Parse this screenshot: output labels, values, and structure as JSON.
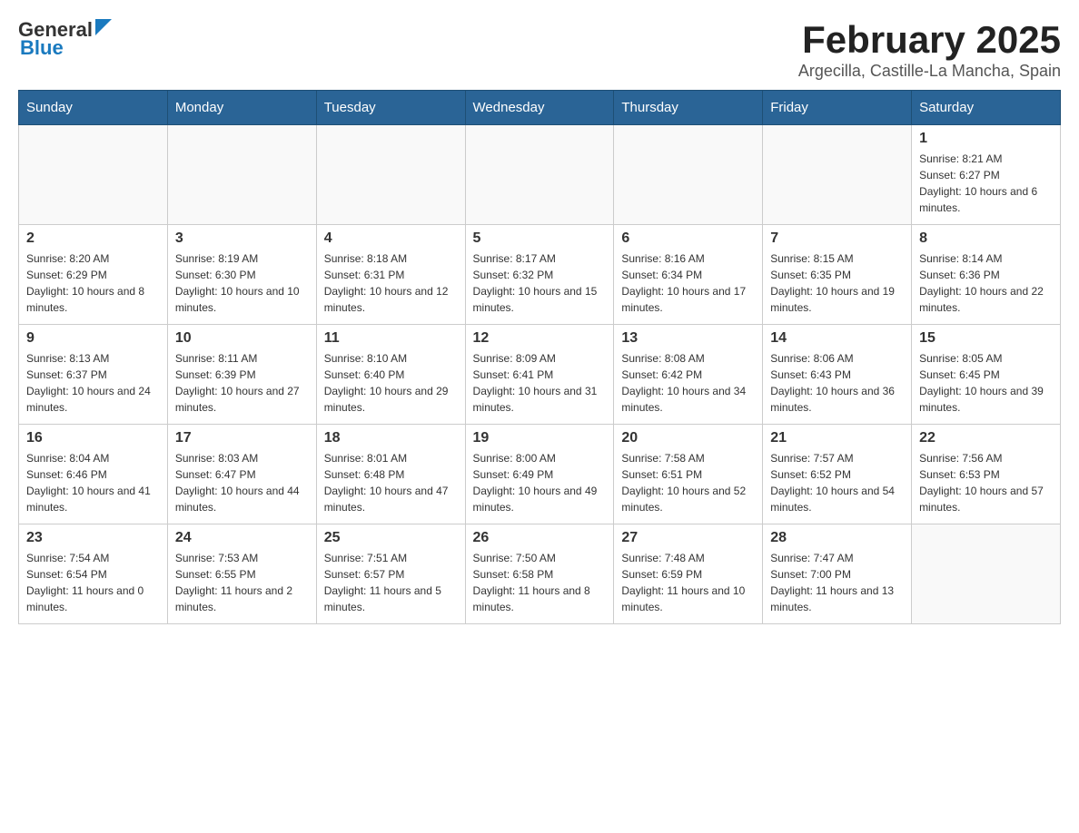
{
  "logo": {
    "general": "General",
    "blue": "Blue"
  },
  "title": "February 2025",
  "location": "Argecilla, Castille-La Mancha, Spain",
  "weekdays": [
    "Sunday",
    "Monday",
    "Tuesday",
    "Wednesday",
    "Thursday",
    "Friday",
    "Saturday"
  ],
  "weeks": [
    [
      {
        "day": "",
        "info": ""
      },
      {
        "day": "",
        "info": ""
      },
      {
        "day": "",
        "info": ""
      },
      {
        "day": "",
        "info": ""
      },
      {
        "day": "",
        "info": ""
      },
      {
        "day": "",
        "info": ""
      },
      {
        "day": "1",
        "info": "Sunrise: 8:21 AM\nSunset: 6:27 PM\nDaylight: 10 hours and 6 minutes."
      }
    ],
    [
      {
        "day": "2",
        "info": "Sunrise: 8:20 AM\nSunset: 6:29 PM\nDaylight: 10 hours and 8 minutes."
      },
      {
        "day": "3",
        "info": "Sunrise: 8:19 AM\nSunset: 6:30 PM\nDaylight: 10 hours and 10 minutes."
      },
      {
        "day": "4",
        "info": "Sunrise: 8:18 AM\nSunset: 6:31 PM\nDaylight: 10 hours and 12 minutes."
      },
      {
        "day": "5",
        "info": "Sunrise: 8:17 AM\nSunset: 6:32 PM\nDaylight: 10 hours and 15 minutes."
      },
      {
        "day": "6",
        "info": "Sunrise: 8:16 AM\nSunset: 6:34 PM\nDaylight: 10 hours and 17 minutes."
      },
      {
        "day": "7",
        "info": "Sunrise: 8:15 AM\nSunset: 6:35 PM\nDaylight: 10 hours and 19 minutes."
      },
      {
        "day": "8",
        "info": "Sunrise: 8:14 AM\nSunset: 6:36 PM\nDaylight: 10 hours and 22 minutes."
      }
    ],
    [
      {
        "day": "9",
        "info": "Sunrise: 8:13 AM\nSunset: 6:37 PM\nDaylight: 10 hours and 24 minutes."
      },
      {
        "day": "10",
        "info": "Sunrise: 8:11 AM\nSunset: 6:39 PM\nDaylight: 10 hours and 27 minutes."
      },
      {
        "day": "11",
        "info": "Sunrise: 8:10 AM\nSunset: 6:40 PM\nDaylight: 10 hours and 29 minutes."
      },
      {
        "day": "12",
        "info": "Sunrise: 8:09 AM\nSunset: 6:41 PM\nDaylight: 10 hours and 31 minutes."
      },
      {
        "day": "13",
        "info": "Sunrise: 8:08 AM\nSunset: 6:42 PM\nDaylight: 10 hours and 34 minutes."
      },
      {
        "day": "14",
        "info": "Sunrise: 8:06 AM\nSunset: 6:43 PM\nDaylight: 10 hours and 36 minutes."
      },
      {
        "day": "15",
        "info": "Sunrise: 8:05 AM\nSunset: 6:45 PM\nDaylight: 10 hours and 39 minutes."
      }
    ],
    [
      {
        "day": "16",
        "info": "Sunrise: 8:04 AM\nSunset: 6:46 PM\nDaylight: 10 hours and 41 minutes."
      },
      {
        "day": "17",
        "info": "Sunrise: 8:03 AM\nSunset: 6:47 PM\nDaylight: 10 hours and 44 minutes."
      },
      {
        "day": "18",
        "info": "Sunrise: 8:01 AM\nSunset: 6:48 PM\nDaylight: 10 hours and 47 minutes."
      },
      {
        "day": "19",
        "info": "Sunrise: 8:00 AM\nSunset: 6:49 PM\nDaylight: 10 hours and 49 minutes."
      },
      {
        "day": "20",
        "info": "Sunrise: 7:58 AM\nSunset: 6:51 PM\nDaylight: 10 hours and 52 minutes."
      },
      {
        "day": "21",
        "info": "Sunrise: 7:57 AM\nSunset: 6:52 PM\nDaylight: 10 hours and 54 minutes."
      },
      {
        "day": "22",
        "info": "Sunrise: 7:56 AM\nSunset: 6:53 PM\nDaylight: 10 hours and 57 minutes."
      }
    ],
    [
      {
        "day": "23",
        "info": "Sunrise: 7:54 AM\nSunset: 6:54 PM\nDaylight: 11 hours and 0 minutes."
      },
      {
        "day": "24",
        "info": "Sunrise: 7:53 AM\nSunset: 6:55 PM\nDaylight: 11 hours and 2 minutes."
      },
      {
        "day": "25",
        "info": "Sunrise: 7:51 AM\nSunset: 6:57 PM\nDaylight: 11 hours and 5 minutes."
      },
      {
        "day": "26",
        "info": "Sunrise: 7:50 AM\nSunset: 6:58 PM\nDaylight: 11 hours and 8 minutes."
      },
      {
        "day": "27",
        "info": "Sunrise: 7:48 AM\nSunset: 6:59 PM\nDaylight: 11 hours and 10 minutes."
      },
      {
        "day": "28",
        "info": "Sunrise: 7:47 AM\nSunset: 7:00 PM\nDaylight: 11 hours and 13 minutes."
      },
      {
        "day": "",
        "info": ""
      }
    ]
  ]
}
